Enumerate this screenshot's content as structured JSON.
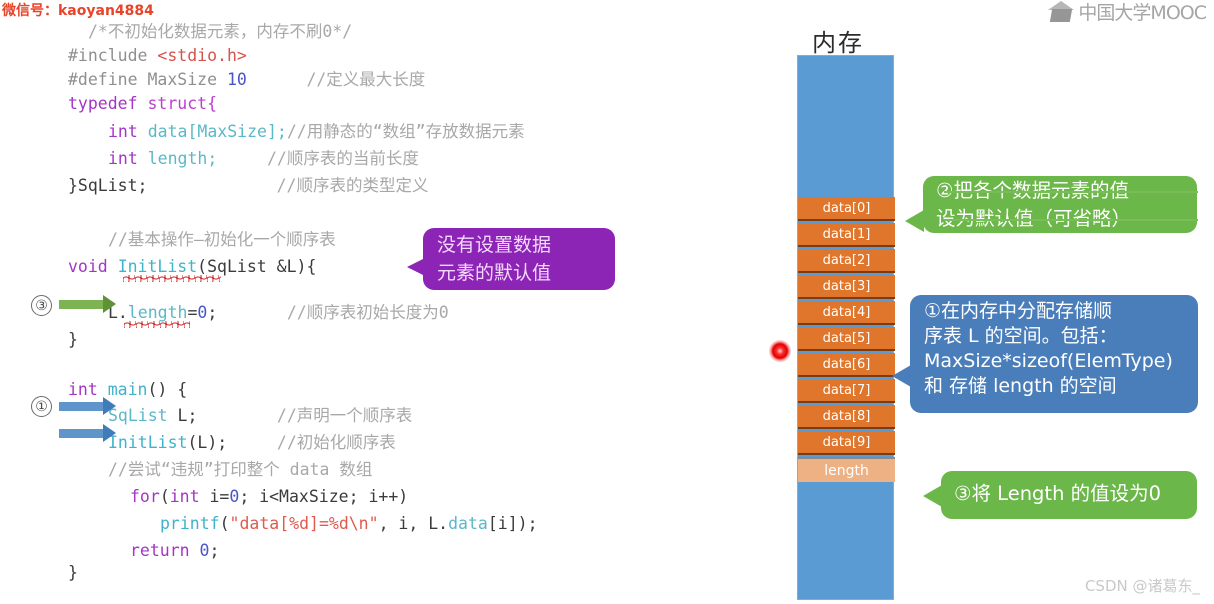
{
  "watermarks": {
    "wechat": "微信号：kaoyan4884",
    "csdn": "CSDN @诸葛东_",
    "mooc_logo_text": "中国大学MOOC"
  },
  "code": {
    "lines": [
      "/*不初始化数据元素，内存不刷0*/",
      "#include <stdio.h>",
      "#define MaxSize 10        //定义最大长度",
      "typedef struct{",
      "    int data[MaxSize];//用静态的“数组”存放数据元素",
      "    int length;       //顺序表的当前长度",
      "}SqList;              //顺序表的类型定义",
      "",
      "    //基本操作—初始化一个顺序表",
      "    void InitList(SqList &L){",
      "        L.length=0;       //顺序表初始长度为0",
      "    }",
      "",
      "    int main() {",
      "        SqList L;         //声明一个顺序表",
      "        InitList(L);      //初始化顺序表",
      "        //尝试“违规”打印整个 data 数组",
      "        for(int i=0; i<MaxSize; i++)",
      "            printf(\"data[%d]=%d\\n\", i, L.data[i]);",
      "        return 0;",
      "    }"
    ],
    "tokens": {
      "comment_1": "/*不初始化数据元素，内存不刷0*/",
      "include_directive": "#include",
      "include_header": "<stdio.h>",
      "define_directive": "#define MaxSize",
      "define_value": "10",
      "comment_maxsize": "//定义最大长度",
      "typedef_kw": "typedef",
      "struct_kw": "struct{",
      "int_kw": "int",
      "data_member": "data[MaxSize];",
      "comment_data": "//用静态的“数组”存放数据元素",
      "length_member": "length;",
      "comment_length": "//顺序表的当前长度",
      "sqlist_close": "}SqList;",
      "comment_sqlist": "//顺序表的类型定义",
      "comment_initlist": "//基本操作—初始化一个顺序表",
      "void_kw": "void",
      "initlist_name": "InitList",
      "initlist_params": "(SqList &L){",
      "length_assign": "L.",
      "length_assign_field": "length",
      "length_assign_eq": "=",
      "length_assign_val": "0",
      "length_assign_semi": ";",
      "comment_initlen": "//顺序表初始长度为0",
      "brace_close": "}",
      "main_int": "int",
      "main_name": "main",
      "main_rest": "() {",
      "sqlist_decl_type": "SqList",
      "sqlist_decl_var": " L;",
      "comment_decl": "//声明一个顺序表",
      "initlist_call": "InitList",
      "initlist_call_args": "(L);",
      "comment_init": "//初始化顺序表",
      "comment_print": "//尝试“违规”打印整个 data 数组",
      "for_kw": "for",
      "for_open": "(",
      "for_int": "int",
      "for_i": " i=",
      "for_zero": "0",
      "for_semi": "; i<MaxSize; i++)",
      "printf_name": "printf",
      "printf_open": "(",
      "printf_str": "\"data[%d]=%d\\n\"",
      "printf_args1": ", i, L.",
      "printf_args2": "data",
      "printf_args3": "[i]);",
      "return_kw": "return",
      "return_val": "0",
      "return_semi": ";"
    }
  },
  "markers": {
    "step3_circle": "③",
    "step1_circle": "①"
  },
  "callouts": {
    "purple": {
      "line1": "没有设置数据",
      "line2": "元素的默认值"
    },
    "green_step2": {
      "line1": "②把各个数据元素的值",
      "line2": "设为默认值（可省略）",
      "struck_out": true,
      "color": "#6cb749"
    },
    "blue_step1": {
      "line1": "①在内存中分配存储顺",
      "line2": "序表 L 的空间。包括：",
      "line3": "MaxSize*sizeof(ElemType)",
      "line4": "和 存储 length 的空间",
      "color": "#4a7ebb"
    },
    "green_step3": {
      "text": "③将 Length 的值设为0",
      "color": "#6cb749"
    }
  },
  "memory": {
    "title": "内存",
    "free_color": "#5b9bd3",
    "data_color": "#e0762c",
    "length_color": "#eeb183",
    "cells": [
      "data[0]",
      "data[1]",
      "data[2]",
      "data[3]",
      "data[4]",
      "data[5]",
      "data[6]",
      "data[7]",
      "data[8]",
      "data[9]"
    ],
    "length_label": "length"
  },
  "pointer": {
    "laser_dot_color": "#ff2b2b"
  }
}
